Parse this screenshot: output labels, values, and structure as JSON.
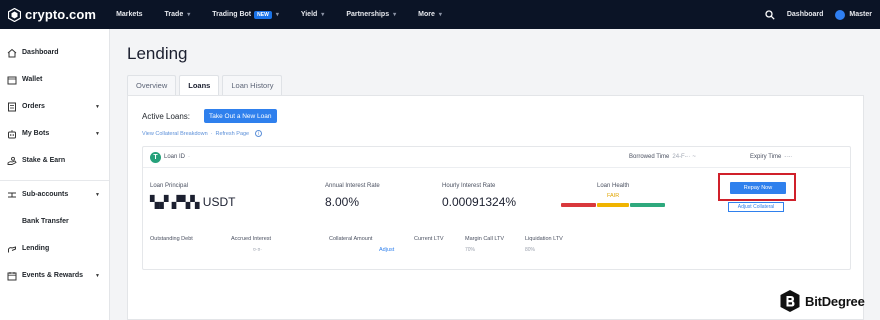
{
  "nav": {
    "logo": "crypto.com",
    "links": [
      {
        "label": "Markets",
        "chevron": false
      },
      {
        "label": "Trade",
        "chevron": true
      },
      {
        "label": "Trading Bot",
        "badge": "NEW",
        "chevron": true
      },
      {
        "label": "Yield",
        "chevron": true
      },
      {
        "label": "Partnerships",
        "chevron": true
      },
      {
        "label": "More",
        "chevron": true
      }
    ],
    "search_icon": "search-icon",
    "dashboard": "Dashboard",
    "user": "Master"
  },
  "sidebar": {
    "items": [
      {
        "label": "Dashboard",
        "icon": "home-icon"
      },
      {
        "label": "Wallet",
        "icon": "wallet-icon"
      },
      {
        "label": "Orders",
        "icon": "orders-icon",
        "caret": true
      },
      {
        "label": "My Bots",
        "icon": "bot-icon",
        "caret": true
      },
      {
        "label": "Stake & Earn",
        "icon": "stake-icon"
      },
      {
        "label": "Sub-accounts",
        "icon": "sub-accounts-icon",
        "caret": true
      },
      {
        "label": "Bank Transfer",
        "icon": "bank-icon"
      },
      {
        "label": "Lending",
        "icon": "lending-icon"
      },
      {
        "label": "Events & Rewards",
        "icon": "events-icon",
        "caret": true
      }
    ]
  },
  "page": {
    "title": "Lending",
    "tabs": [
      "Overview",
      "Loans",
      "Loan History"
    ],
    "active_tab": "Loans"
  },
  "loans": {
    "active_label": "Active Loans:",
    "take_out_button": "Take Out a New Loan",
    "view_breakdown": "View Collateral Breakdown",
    "refresh": "Refresh Page",
    "card": {
      "loan_id_label": "Loan ID",
      "loan_id_value": "·",
      "borrowed_time_label": "Borrowed Time",
      "borrowed_time_value": "24-F-·· ~",
      "expiry_time_label": "Expiry Time",
      "expiry_time_value": "-·-·",
      "loan_principal_label": "Loan Principal",
      "loan_principal_value": "▚▞ ▞▚▚ USDT",
      "annual_rate_label": "Annual Interest Rate",
      "annual_rate_value": "8.00%",
      "hourly_rate_label": "Hourly Interest Rate",
      "hourly_rate_value": "0.00091324%",
      "loan_health_label": "Loan Health",
      "loan_health_value": "FAIR",
      "health_colors": [
        "#d9383c",
        "#f0b400",
        "#2ea97d"
      ],
      "repay_button": "Repay Now",
      "adjust_collateral_button": "Adjust Collateral",
      "outstanding_debt_label": "Outstanding Debt",
      "accrued_interest_label": "Accrued Interest",
      "accrued_interest_value": "¤·¤·",
      "collateral_amount_label": "Collateral Amount",
      "adjust_link": "Adjust",
      "current_ltv_label": "Current LTV",
      "margin_call_ltv_label": "Margin Call LTV",
      "margin_call_ltv_value": "70%",
      "liquidation_ltv_label": "Liquidation LTV",
      "liquidation_ltv_value": "80%"
    }
  },
  "watermark": {
    "text": "BitDegree"
  },
  "colors": {
    "nav_bg": "#0b1426",
    "accent": "#2f80ed",
    "highlight_box": "#d0202a"
  }
}
